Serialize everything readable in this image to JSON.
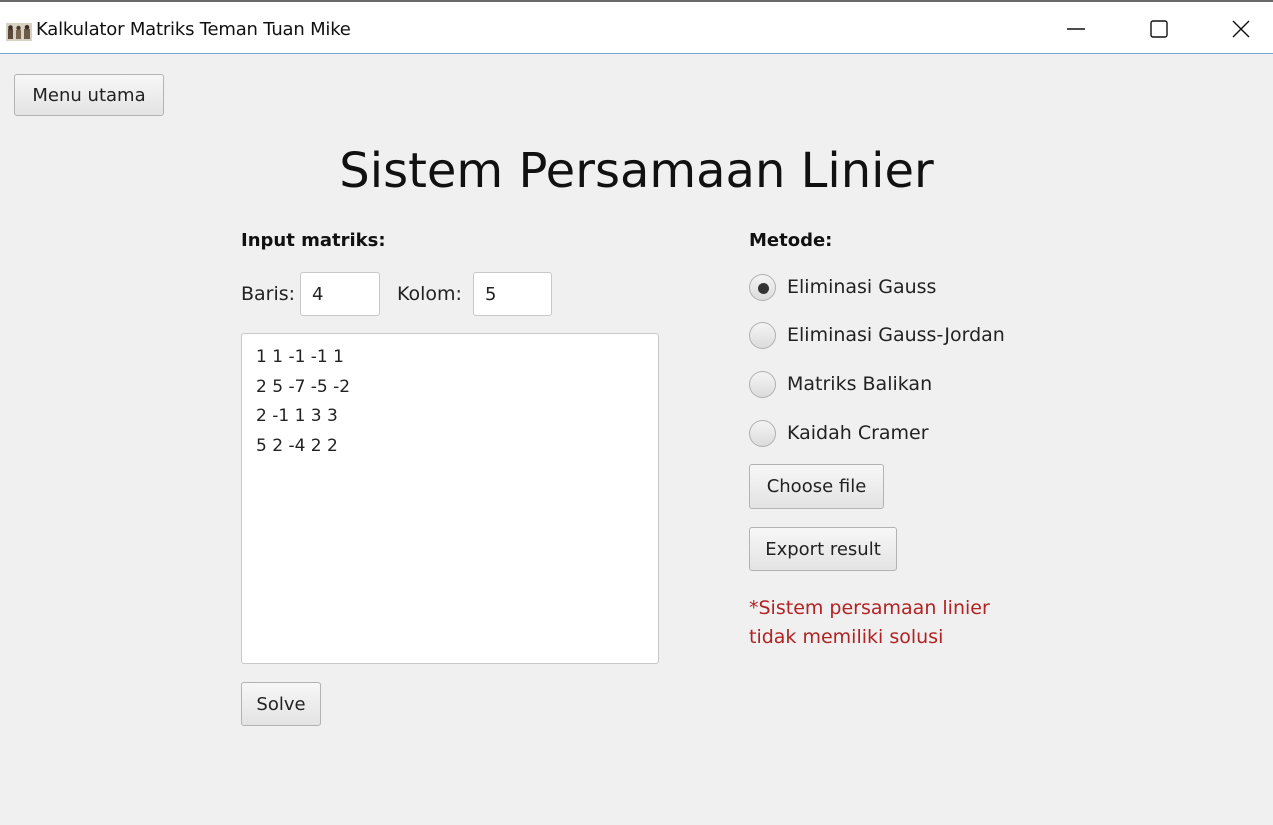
{
  "window": {
    "title": "Kalkulator Matriks Teman Tuan Mike",
    "app_icon": "app-photo-icon",
    "controls": [
      "minimize-icon",
      "maximize-icon",
      "close-icon"
    ]
  },
  "nav": {
    "menu_label": "Menu utama"
  },
  "page": {
    "title": "Sistem Persamaan Linier"
  },
  "input": {
    "heading": "Input matriks:",
    "rows_label": "Baris:",
    "rows_value": "4",
    "cols_label": "Kolom:",
    "cols_value": "5",
    "matrix_text": "1 1 -1 -1 1\n2 5 -7 -5 -2\n2 -1 1 3 3\n5 2 -4 2 2",
    "solve_label": "Solve"
  },
  "method": {
    "heading": "Metode:",
    "options": [
      {
        "label": "Eliminasi Gauss",
        "selected": true
      },
      {
        "label": "Eliminasi Gauss-Jordan",
        "selected": false
      },
      {
        "label": "Matriks Balikan",
        "selected": false
      },
      {
        "label": "Kaidah Cramer",
        "selected": false
      }
    ],
    "choose_file_label": "Choose file",
    "export_label": "Export result"
  },
  "result": {
    "message_line1": "*Sistem persamaan linier",
    "message_line2": "tidak memiliki solusi",
    "message_color": "#b22222"
  }
}
